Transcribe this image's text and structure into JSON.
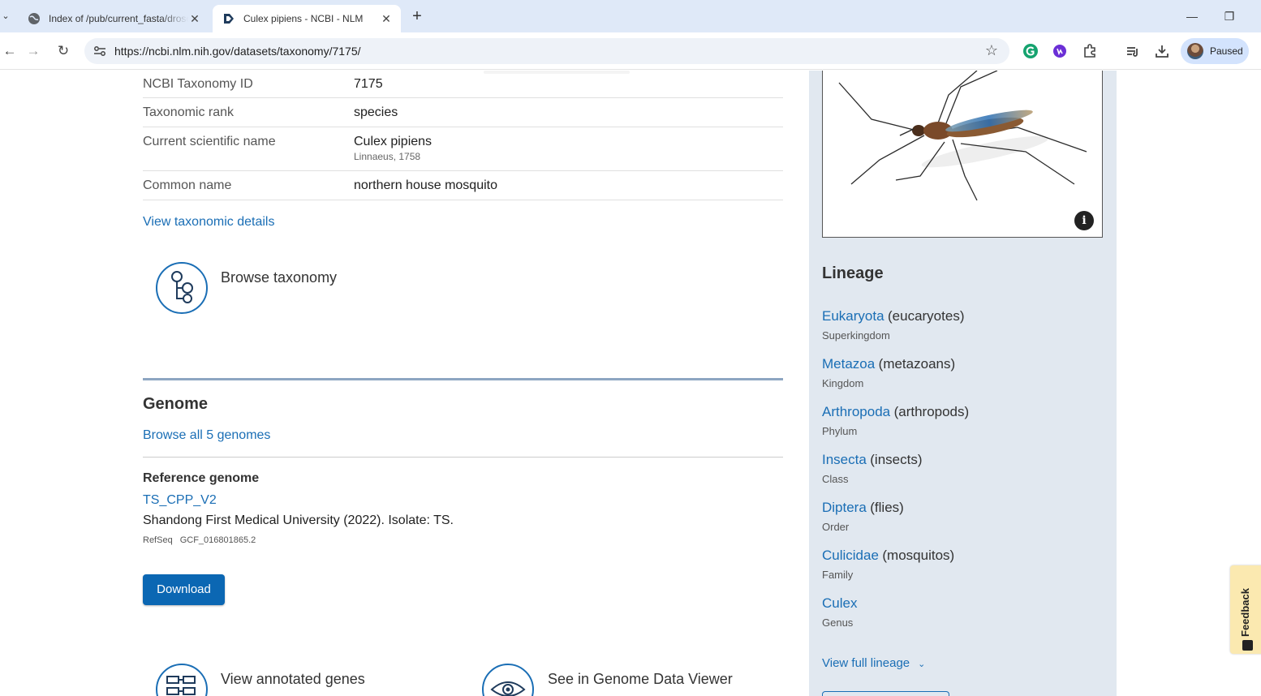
{
  "browser": {
    "tabs": [
      {
        "title": "Index of /pub/current_fasta/drosophila",
        "active": false
      },
      {
        "title": "Culex pipiens - NCBI - NLM",
        "active": true
      }
    ],
    "url": "https://ncbi.nlm.nih.gov/datasets/taxonomy/7175/",
    "profile_label": "Paused",
    "icons": {
      "back": "arrow-left-icon",
      "forward": "arrow-right-icon",
      "reload": "reload-icon",
      "bookmark": "star-icon"
    }
  },
  "facts": [
    {
      "label": "NCBI Taxonomy ID",
      "value": "7175",
      "sub": ""
    },
    {
      "label": "Taxonomic rank",
      "value": "species",
      "sub": ""
    },
    {
      "label": "Current scientific name",
      "value": "Culex pipiens",
      "sub": "Linnaeus, 1758"
    },
    {
      "label": "Common name",
      "value": "northern house mosquito",
      "sub": ""
    }
  ],
  "view_taxonomic_details": "View taxonomic details",
  "browse_taxonomy": "Browse taxonomy",
  "genome": {
    "heading": "Genome",
    "browse_all": "Browse all 5 genomes",
    "reference_heading": "Reference genome",
    "accession_name": "TS_CPP_V2",
    "description": "Shandong First Medical University (2022). Isolate: TS.",
    "refseq_label": "RefSeq",
    "refseq_accession": "GCF_016801865.2",
    "download_label": "Download"
  },
  "tools": {
    "annotated_genes": "View annotated genes",
    "genome_data_viewer": "See in Genome Data Viewer"
  },
  "lineage": {
    "heading": "Lineage",
    "items": [
      {
        "name": "Eukaryota",
        "common": "(eucaryotes)",
        "rank": "Superkingdom"
      },
      {
        "name": "Metazoa",
        "common": "(metazoans)",
        "rank": "Kingdom"
      },
      {
        "name": "Arthropoda",
        "common": "(arthropods)",
        "rank": "Phylum"
      },
      {
        "name": "Insecta",
        "common": "(insects)",
        "rank": "Class"
      },
      {
        "name": "Diptera",
        "common": "(flies)",
        "rank": "Order"
      },
      {
        "name": "Culicidae",
        "common": "(mosquitos)",
        "rank": "Family"
      },
      {
        "name": "Culex",
        "common": "",
        "rank": "Genus"
      }
    ],
    "view_full": "View full lineage"
  },
  "photo_info": "i",
  "feedback": "Feedback"
}
